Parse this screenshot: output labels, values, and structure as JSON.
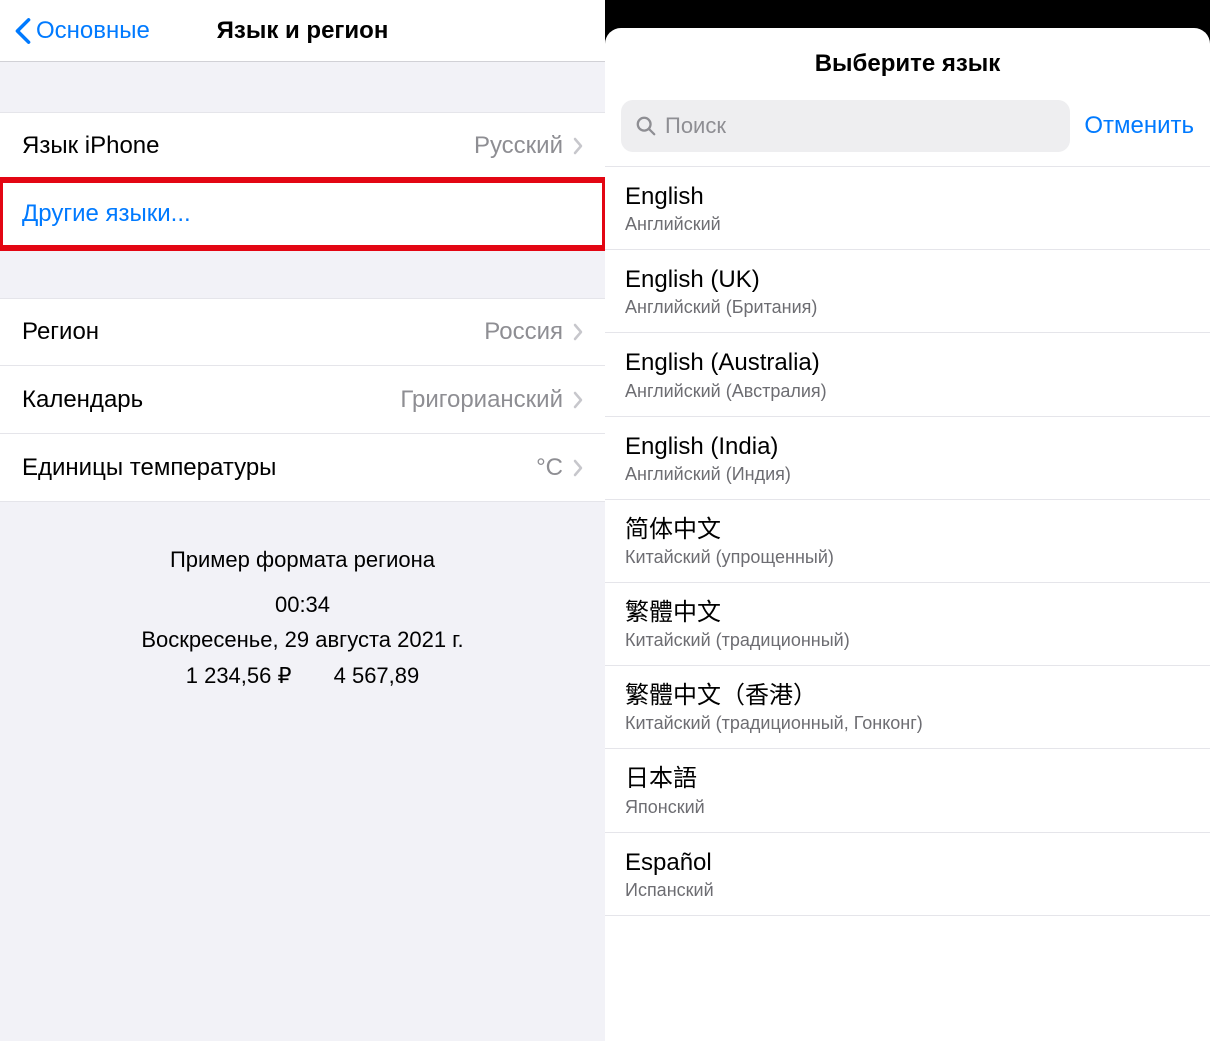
{
  "left": {
    "back_label": "Основные",
    "title": "Язык и регион",
    "rows": {
      "iphone_lang": {
        "label": "Язык iPhone",
        "value": "Русский"
      },
      "other_langs": {
        "label": "Другие языки..."
      },
      "region": {
        "label": "Регион",
        "value": "Россия"
      },
      "calendar": {
        "label": "Календарь",
        "value": "Григорианский"
      },
      "temp_units": {
        "label": "Единицы температуры",
        "value": "°C"
      }
    },
    "example": {
      "heading": "Пример формата региона",
      "time": "00:34",
      "date": "Воскресенье, 29 августа 2021 г.",
      "num1": "1 234,56 ₽",
      "num2": "4 567,89"
    }
  },
  "right": {
    "title": "Выберите язык",
    "search_placeholder": "Поиск",
    "cancel": "Отменить",
    "languages": [
      {
        "name": "English",
        "sub": "Английский"
      },
      {
        "name": "English (UK)",
        "sub": "Английский (Британия)"
      },
      {
        "name": "English (Australia)",
        "sub": "Английский (Австралия)"
      },
      {
        "name": "English (India)",
        "sub": "Английский (Индия)"
      },
      {
        "name": "简体中文",
        "sub": "Китайский (упрощенный)"
      },
      {
        "name": "繁體中文",
        "sub": "Китайский (традиционный)"
      },
      {
        "name": "繁體中文（香港）",
        "sub": "Китайский (традиционный, Гонконг)"
      },
      {
        "name": "日本語",
        "sub": "Японский"
      },
      {
        "name": "Español",
        "sub": "Испанский"
      }
    ]
  }
}
